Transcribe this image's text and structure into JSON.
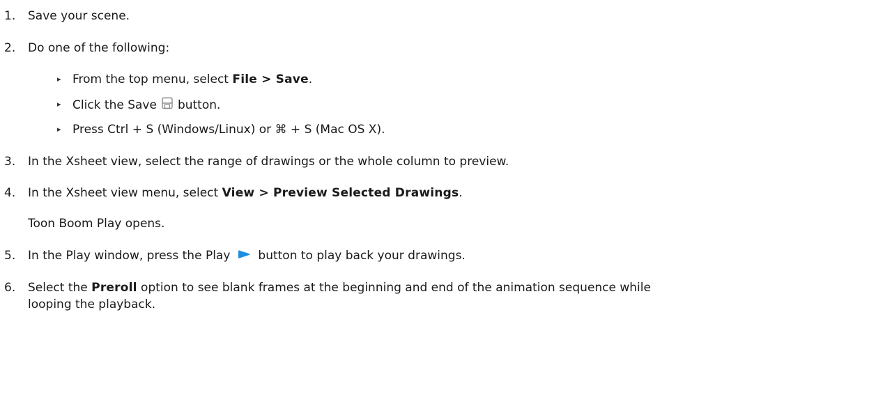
{
  "steps": [
    {
      "num": "1.",
      "text": "Save your scene."
    },
    {
      "num": "2.",
      "text": "Do one of the following:"
    },
    {
      "num": "3.",
      "text": "In the Xsheet view, select the range of drawings or the whole column to preview."
    },
    {
      "num": "4.",
      "pre": "In the Xsheet view menu, select ",
      "bold": "View > Preview Selected Drawings",
      "post": "."
    },
    {
      "num": "5.",
      "pre": "In the Play window, press the Play",
      "post": "button to play back your drawings."
    },
    {
      "num": "6.",
      "pre": "Select the ",
      "bold": "Preroll",
      "post": " option to see blank frames at the beginning and end of the animation sequence while",
      "line2": "looping the playback."
    }
  ],
  "substeps": [
    {
      "pre": "From the top menu, select ",
      "bold": "File > Save",
      "post": "."
    },
    {
      "pre": "Click the Save",
      "post": "button."
    },
    {
      "text": "Press Ctrl + S (Windows/Linux) or ⌘ + S (Mac OS X)."
    }
  ],
  "step4_note": "Toon Boom Play opens.",
  "bullet_glyph": "▸",
  "icons": {
    "save": "save-icon",
    "play": "play-icon"
  },
  "colors": {
    "play_icon": "#1e8fe0",
    "save_icon": "#8a8a8a"
  }
}
